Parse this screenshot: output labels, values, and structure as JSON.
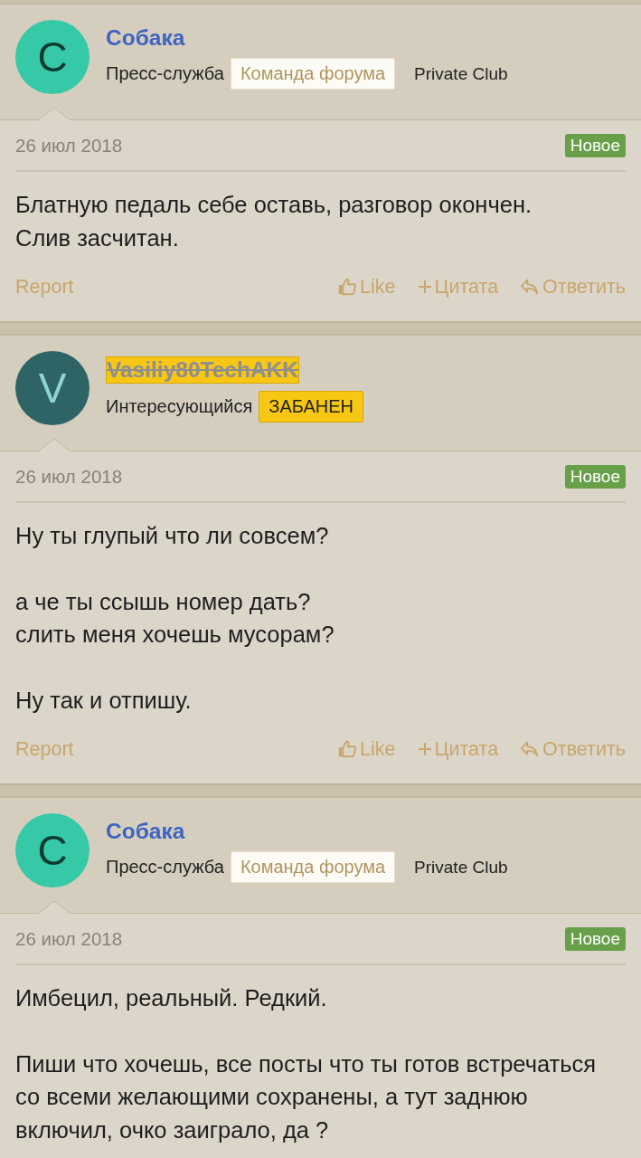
{
  "posts": [
    {
      "avatar_letter": "С",
      "color": "#36c9a7",
      "author": "Собака",
      "banned": false,
      "user_title": "Пресс-служба",
      "banners": [
        {
          "kind": "staff",
          "text": "Команда форума"
        },
        {
          "kind": "plain",
          "text": "Private Club"
        }
      ],
      "date": "26 июл 2018",
      "new_label": "Новое",
      "paragraphs": [
        [
          "Блатную педаль себе оставь, разговор окончен.",
          "Слив засчитан."
        ]
      ],
      "actions": {
        "report": "Report",
        "like": "Like",
        "quote": "Цитата",
        "reply": "Ответить"
      }
    },
    {
      "avatar_letter": "V",
      "color": "#2e6466",
      "author": "Vasiliy80TechAKK",
      "banned": true,
      "user_title": "Интересующийся",
      "banners": [
        {
          "kind": "banned",
          "text": "ЗАБАНЕН"
        }
      ],
      "date": "26 июл 2018",
      "new_label": "Новое",
      "paragraphs": [
        [
          "Ну ты глупый что ли совсем?"
        ],
        [
          "а че ты ссышь номер дать?",
          "слить меня хочешь мусорам?"
        ],
        [
          "Ну так и отпишу."
        ]
      ],
      "actions": {
        "report": "Report",
        "like": "Like",
        "quote": "Цитата",
        "reply": "Ответить"
      }
    },
    {
      "avatar_letter": "С",
      "color": "#36c9a7",
      "author": "Собака",
      "banned": false,
      "user_title": "Пресс-служба",
      "banners": [
        {
          "kind": "staff",
          "text": "Команда форума"
        },
        {
          "kind": "plain",
          "text": "Private Club"
        }
      ],
      "date": "26 июл 2018",
      "new_label": "Новое",
      "paragraphs": [
        [
          "Имбецил, реальный. Редкий."
        ],
        [
          "Пиши что хочешь, все посты что ты готов встречаться со всеми желающими сохранены, а тут заднюю включил, очко заиграло, да ?"
        ]
      ]
    }
  ]
}
